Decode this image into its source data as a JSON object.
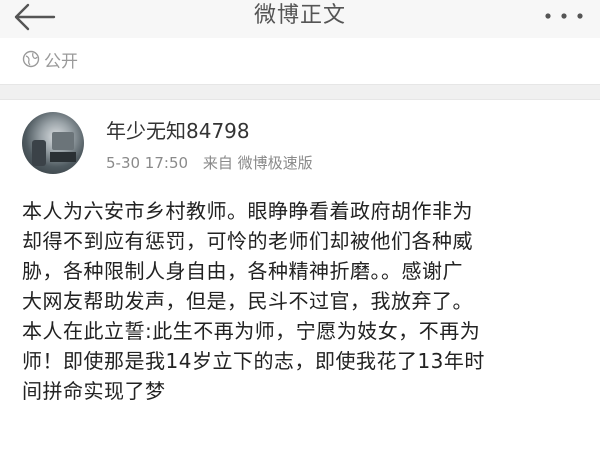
{
  "nav": {
    "title": "微博正文",
    "back_icon": "back-arrow-icon",
    "more_icon": "more-dots-icon"
  },
  "visibility": {
    "icon": "globe-icon",
    "label": "公开"
  },
  "post": {
    "author": {
      "name": "年少无知84798",
      "avatar": "avatar"
    },
    "time": "5-30 17:50",
    "source": "来自 微博极速版",
    "lines": [
      "本人为六安市乡村教师。眼睁睁看着政府胡作非为",
      "却得不到应有惩罚，可怜的老师们却被他们各种威",
      "胁，各种限制人身自由，各种精神折磨。。感谢广",
      "大网友帮助发声，但是，民斗不过官，我放弃了。",
      "本人在此立誓:此生不再为师，宁愿为妓女，不再为",
      "师！即使那是我14岁立下的志，即使我花了13年时",
      "间拼命实现了梦"
    ]
  },
  "colors": {
    "nav_bg": "#f7f7f7",
    "meta_text": "#8a8a8a",
    "body_text": "#222222",
    "divider_bg": "#f0f0f0"
  }
}
